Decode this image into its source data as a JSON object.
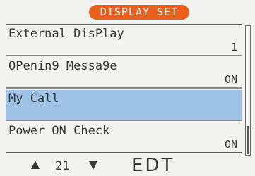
{
  "header": {
    "title": "DISPLAY SET"
  },
  "menu": {
    "items": [
      {
        "label": "External DisPlay",
        "value": "1",
        "selected": false
      },
      {
        "label": "OPenin9 Messa9e",
        "value": "ON",
        "selected": false
      },
      {
        "label": "My Call",
        "value": "",
        "selected": true
      },
      {
        "label": "Power ON Check",
        "value": "ON",
        "selected": false
      }
    ]
  },
  "scrollbar": {
    "position_fraction": 0.8
  },
  "footer": {
    "up_icon": "triangle-up-icon",
    "channel": "21",
    "down_icon": "triangle-down-icon",
    "edit_label": "EDT"
  },
  "colors": {
    "title_pill": "#e8601c",
    "selected_row": "#9ec3e6",
    "background": "#f2f2f0",
    "text": "#3a3a3a"
  }
}
